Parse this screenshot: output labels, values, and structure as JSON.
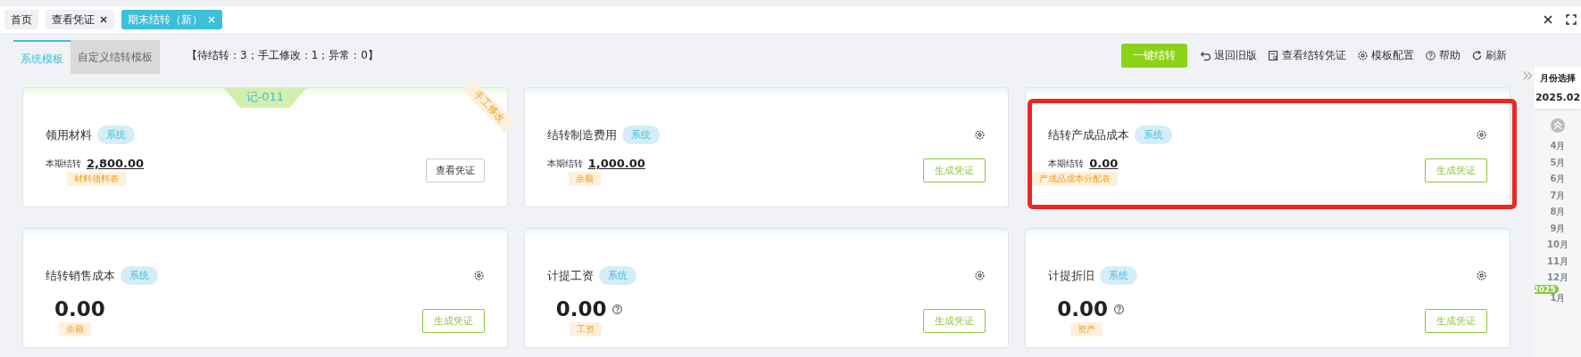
{
  "page_tabs": [
    {
      "label": "首页",
      "closable": false,
      "selected": false
    },
    {
      "label": "查看凭证",
      "closable": true,
      "selected": false
    },
    {
      "label": "期末结转（新）",
      "closable": true,
      "selected": true
    }
  ],
  "template_tabs": [
    {
      "label": "系统模板",
      "selected": true
    },
    {
      "label": "自定义结转模板",
      "selected": false
    }
  ],
  "summary": "【待结转：3；手工修改：1；异常：0】",
  "toolbar": {
    "primary": "一键结转",
    "actions": [
      {
        "label": "退回旧版"
      },
      {
        "label": "查看结转凭证"
      },
      {
        "label": "模板配置"
      },
      {
        "label": "帮助"
      },
      {
        "label": "刷新"
      }
    ]
  },
  "cards": [
    {
      "title": "领用材料",
      "tag": "系统",
      "voucher": "记-011",
      "manual_badge": "手工修改",
      "kind": "period",
      "amount_label": "本期结转",
      "amount": "2,800.00",
      "source": "材料领料表",
      "button": {
        "label": "查看凭证",
        "kind": "view"
      },
      "settings": false,
      "help": false,
      "highlighted": false
    },
    {
      "title": "结转制造费用",
      "tag": "系统",
      "kind": "period",
      "amount_label": "本期结转",
      "amount": "1,000.00",
      "source": "余额",
      "button": {
        "label": "生成凭证",
        "kind": "generate"
      },
      "settings": true,
      "help": false,
      "highlighted": false
    },
    {
      "title": "结转产成品成本",
      "tag": "系统",
      "kind": "period",
      "amount_label": "本期结转",
      "amount": "0.00",
      "source": "产成品成本分配表",
      "button": {
        "label": "生成凭证",
        "kind": "generate"
      },
      "settings": true,
      "help": false,
      "highlighted": true
    },
    {
      "title": "结转销售成本",
      "tag": "系统",
      "kind": "balance",
      "amount": "0.00",
      "source": "余额",
      "button": {
        "label": "生成凭证",
        "kind": "generate"
      },
      "settings": true,
      "help": false,
      "highlighted": false
    },
    {
      "title": "计提工资",
      "tag": "系统",
      "kind": "balance",
      "amount": "0.00",
      "source": "工资",
      "button": {
        "label": "生成凭证",
        "kind": "generate"
      },
      "settings": true,
      "help": true,
      "highlighted": false
    },
    {
      "title": "计提折旧",
      "tag": "系统",
      "kind": "balance",
      "amount": "0.00",
      "source": "资产",
      "button": {
        "label": "生成凭证",
        "kind": "generate"
      },
      "settings": true,
      "help": true,
      "highlighted": false
    }
  ],
  "month_picker": {
    "title": "月份选择",
    "current": "2025.02",
    "months": [
      "4月",
      "5月",
      "6月",
      "7月",
      "8月",
      "9月",
      "10月",
      "11月",
      "12月"
    ],
    "year_badge": "2025",
    "next_month": "1月"
  }
}
